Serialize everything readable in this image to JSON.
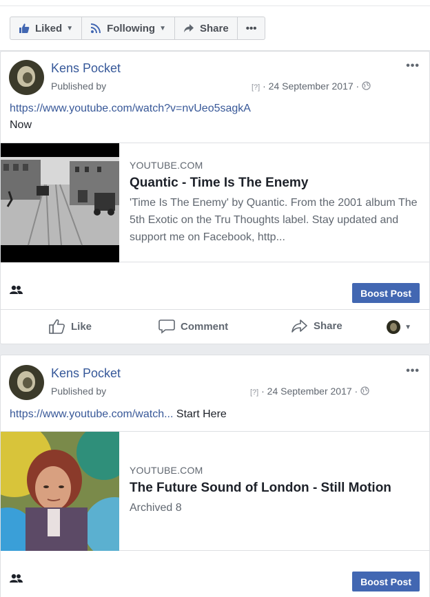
{
  "toolbar": {
    "liked_label": "Liked",
    "following_label": "Following",
    "share_label": "Share",
    "more_label": "•••"
  },
  "posts": [
    {
      "page_name": "Kens Pocket",
      "published_by": "Published by ",
      "help_marker": "[?]",
      "date": "· 24 September 2017 ·",
      "link_text": "https://www.youtube.com/watch?v=nvUeo5sagkA",
      "message": "Now",
      "attachment": {
        "source": "YOUTUBE.COM",
        "title": "Quantic - Time Is The Enemy",
        "description": "'Time Is The Enemy' by Quantic. From the 2001 album The 5th Exotic on the Tru Thoughts label. Stay updated and support me on Facebook, http..."
      },
      "boost_label": "Boost Post",
      "like_label": "Like",
      "comment_label": "Comment",
      "share_label": "Share",
      "options_label": "•••"
    },
    {
      "page_name": "Kens Pocket",
      "published_by": "Published by",
      "help_marker": "[?]",
      "date": "· 24 September 2017 ·",
      "link_text": "https://www.youtube.com/watch...",
      "message": "Start Here",
      "attachment": {
        "source": "YOUTUBE.COM",
        "title": "The Future Sound of London - Still Motion",
        "description": "Archived 8"
      },
      "boost_label": "Boost Post",
      "options_label": "•••"
    }
  ],
  "colors": {
    "link": "#385898",
    "page_name": "#365899",
    "boost_button": "#4267b2",
    "background": "#e9ebee"
  }
}
